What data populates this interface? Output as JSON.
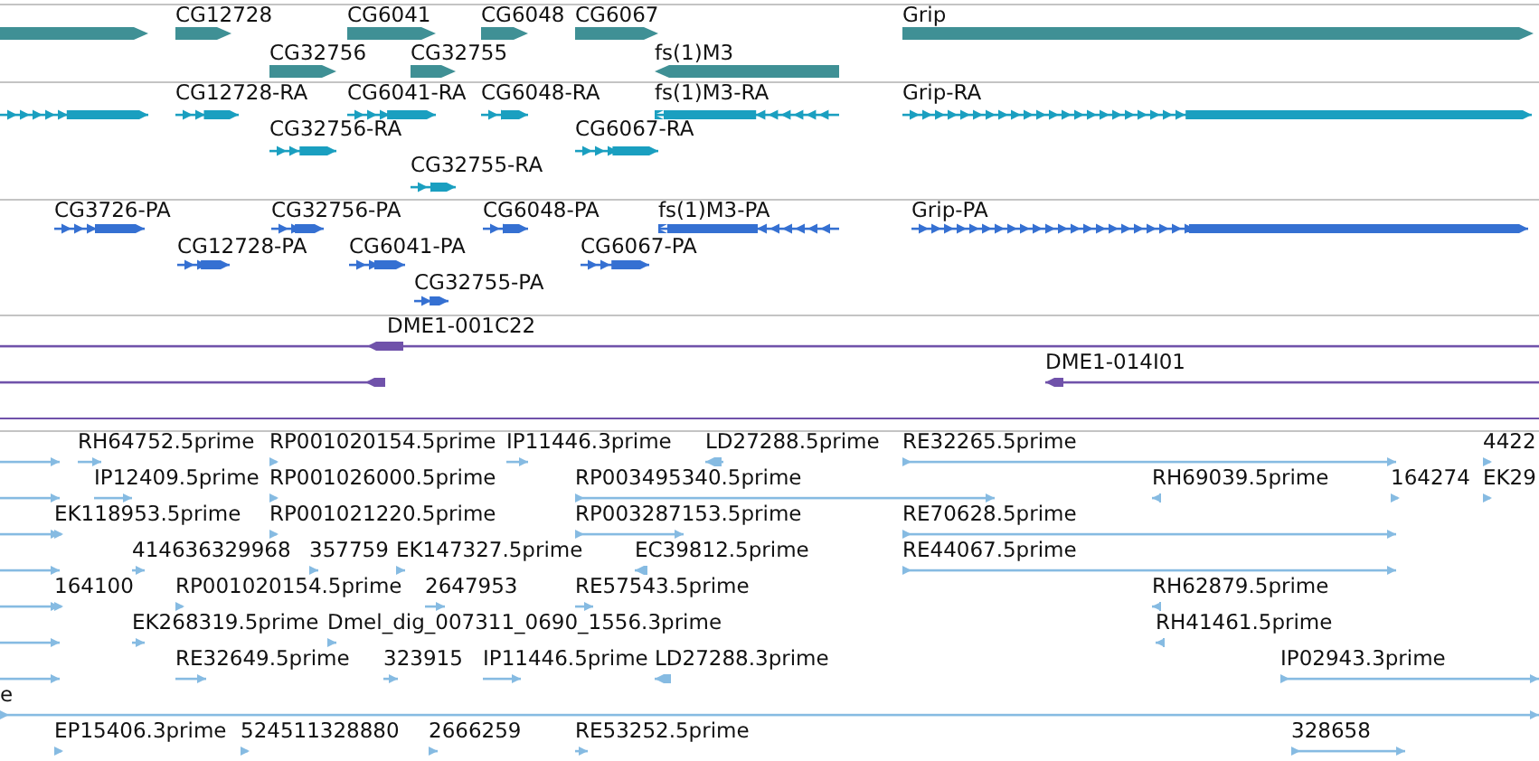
{
  "tracks": [
    {
      "kind": "gene",
      "features": [
        {
          "reverse": false
        },
        {
          "label": "CG12728",
          "reverse": false
        },
        {
          "label": "CG32756",
          "reverse": false
        },
        {
          "label": "CG6041",
          "reverse": false
        },
        {
          "label": "CG32755",
          "reverse": false
        },
        {
          "label": "CG6048",
          "reverse": false
        },
        {
          "label": "CG6067",
          "reverse": false
        },
        {
          "label": "fs(1)M3",
          "reverse": true
        },
        {
          "label": "Grip",
          "reverse": false
        }
      ]
    },
    {
      "kind": "transcript",
      "features": [
        {
          "reverse": false
        },
        {
          "label": "CG12728-RA",
          "reverse": false
        },
        {
          "label": "CG32756-RA",
          "reverse": false
        },
        {
          "label": "CG6041-RA",
          "reverse": false
        },
        {
          "label": "CG32755-RA",
          "reverse": false
        },
        {
          "label": "CG6048-RA",
          "reverse": false
        },
        {
          "label": "CG6067-RA",
          "reverse": false
        },
        {
          "label": "fs(1)M3-RA",
          "reverse": true
        },
        {
          "label": "Grip-RA",
          "reverse": false
        }
      ]
    },
    {
      "kind": "protein",
      "features": [
        {
          "label": "CG3726-PA",
          "reverse": false
        },
        {
          "label": "CG12728-PA",
          "reverse": false
        },
        {
          "label": "CG32756-PA",
          "reverse": false
        },
        {
          "label": "CG6041-PA",
          "reverse": false
        },
        {
          "label": "CG32755-PA",
          "reverse": false
        },
        {
          "label": "CG6048-PA",
          "reverse": false
        },
        {
          "label": "CG6067-PA",
          "reverse": false
        },
        {
          "label": "fs(1)M3-PA",
          "reverse": true
        },
        {
          "label": "Grip-PA",
          "reverse": false
        }
      ]
    },
    {
      "kind": "clone",
      "features": [
        {
          "label": "DME1-001C22",
          "reverse": true
        },
        {
          "reverse": true
        },
        {
          "label": "DME1-014I01",
          "reverse": true
        }
      ]
    },
    {
      "kind": "est",
      "features": [
        {
          "reverse": false
        },
        {
          "reverse": false
        },
        {
          "reverse": false
        },
        {
          "reverse": false
        },
        {
          "reverse": false
        },
        {
          "reverse": false
        },
        {
          "reverse": false
        },
        {
          "label": "RH64752.5prime",
          "reverse": false
        },
        {
          "label": "RP001020154.5prime",
          "reverse": false
        },
        {
          "label": "IP11446.3prime",
          "reverse": false
        },
        {
          "label": "LD27288.5prime",
          "reverse": true
        },
        {
          "label": "RE32265.5prime",
          "reverse": false
        },
        {
          "label": "4422",
          "reverse": false
        },
        {
          "label": "IP12409.5prime",
          "reverse": false
        },
        {
          "label": "RP001026000.5prime",
          "reverse": false
        },
        {
          "label": "RP003495340.5prime",
          "reverse": false
        },
        {
          "label": "RH69039.5prime",
          "reverse": true
        },
        {
          "label": "164274",
          "reverse": false
        },
        {
          "label": "EK29",
          "reverse": false
        },
        {
          "label": "EK118953.5prime",
          "reverse": false
        },
        {
          "label": "RP001021220.5prime",
          "reverse": false
        },
        {
          "label": "RP003287153.5prime",
          "reverse": false
        },
        {
          "label": "RE70628.5prime",
          "reverse": false
        },
        {
          "label": "414636329968",
          "reverse": false
        },
        {
          "label": "357759",
          "reverse": false
        },
        {
          "label": "EK147327.5prime",
          "reverse": false
        },
        {
          "label": "EC39812.5prime",
          "reverse": true
        },
        {
          "label": "RE44067.5prime",
          "reverse": false
        },
        {
          "label": "164100",
          "reverse": false
        },
        {
          "label": "RP001020154.5prime",
          "reverse": false
        },
        {
          "label": "2647953",
          "reverse": false
        },
        {
          "label": "RE57543.5prime",
          "reverse": false
        },
        {
          "label": "RH62879.5prime",
          "reverse": true
        },
        {
          "label": "EK268319.5prime",
          "reverse": false
        },
        {
          "label": "Dmel_dig_007311_0690_1556.3prime",
          "reverse": false
        },
        {
          "label": "RH41461.5prime",
          "reverse": true
        },
        {
          "label": "RE32649.5prime",
          "reverse": false
        },
        {
          "label": "323915",
          "reverse": false
        },
        {
          "label": "IP11446.5prime",
          "reverse": false
        },
        {
          "label": "LD27288.3prime",
          "reverse": true
        },
        {
          "label": "IP02943.3prime",
          "reverse": false
        },
        {
          "label": "e",
          "reverse": false
        },
        {
          "label": "EP15406.3prime",
          "reverse": false
        },
        {
          "label": "524511328880",
          "reverse": false
        },
        {
          "label": "2666259",
          "reverse": false
        },
        {
          "label": "RE53252.5prime",
          "reverse": false
        },
        {
          "label": "328658",
          "reverse": false
        }
      ]
    }
  ]
}
